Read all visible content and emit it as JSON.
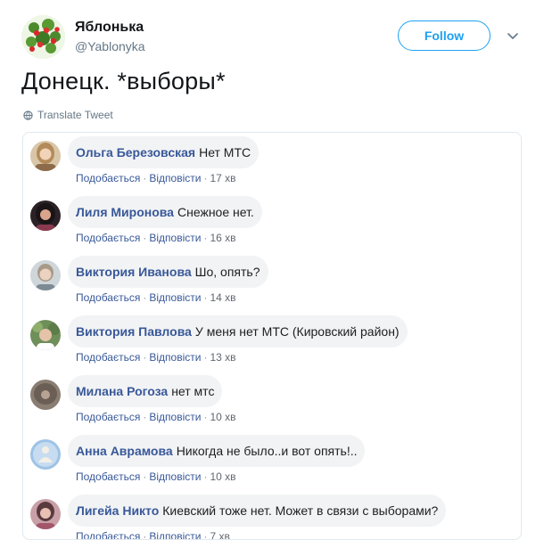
{
  "tweet": {
    "author_name": "Яблонька",
    "author_handle": "@Yablonyka",
    "follow_label": "Follow",
    "text": "Донецк. *выборы*",
    "translate_label": "Translate Tweet"
  },
  "comments": [
    {
      "author": "Ольга Березовская",
      "text": "Нет МТС",
      "like": "Подобається",
      "reply": "Відповісти",
      "time": "17 хв"
    },
    {
      "author": "Лиля Миронова",
      "text": "Снежное нет.",
      "like": "Подобається",
      "reply": "Відповісти",
      "time": "16 хв"
    },
    {
      "author": "Виктория Иванова",
      "text": "Шо, опять?",
      "like": "Подобається",
      "reply": "Відповісти",
      "time": "14 хв"
    },
    {
      "author": "Виктория Павлова",
      "text": "У меня нет МТС (Кировский район)",
      "like": "Подобається",
      "reply": "Відповісти",
      "time": "13 хв"
    },
    {
      "author": "Милана Рогоза",
      "text": "нет мтс",
      "like": "Подобається",
      "reply": "Відповісти",
      "time": "10 хв"
    },
    {
      "author": "Анна Аврамова",
      "text": "Никогда не было..и вот опять!..",
      "like": "Подобається",
      "reply": "Відповісти",
      "time": "10 хв"
    },
    {
      "author": "Лигейа Никто",
      "text": "Киевский тоже нет. Может в связи с выборами?",
      "like": "Подобається",
      "reply": "Відповісти",
      "time": "7 хв"
    }
  ],
  "colors": {
    "follow_accent": "#1da1f2",
    "comment_author": "#385898",
    "bubble_bg": "#f2f3f5"
  }
}
